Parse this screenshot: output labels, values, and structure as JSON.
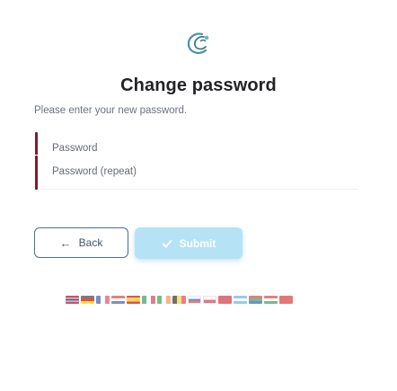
{
  "brand": {
    "logo_icon": "leaf-swirl-logo-icon",
    "accent": "#4a90a4"
  },
  "title": "Change password",
  "subtitle": "Please enter your new password.",
  "fields": {
    "password": {
      "placeholder": "Password",
      "value": ""
    },
    "password_repeat": {
      "placeholder": "Password (repeat)",
      "value": ""
    }
  },
  "buttons": {
    "back": {
      "label": "Back",
      "icon": "arrow-left-icon"
    },
    "submit": {
      "label": "Submit",
      "icon": "check-icon",
      "color": "#b6e2f5"
    }
  },
  "languages": [
    {
      "code": "gb",
      "icon": "flag-gb-icon"
    },
    {
      "code": "de",
      "icon": "flag-de-icon"
    },
    {
      "code": "fr",
      "icon": "flag-fr-icon"
    },
    {
      "code": "nl",
      "icon": "flag-nl-icon"
    },
    {
      "code": "es",
      "icon": "flag-es-icon"
    },
    {
      "code": "it",
      "icon": "flag-it-icon"
    },
    {
      "code": "ie",
      "icon": "flag-ie-icon"
    },
    {
      "code": "be",
      "icon": "flag-be-icon"
    },
    {
      "code": "ru",
      "icon": "flag-ru-icon"
    },
    {
      "code": "pl",
      "icon": "flag-pl-icon"
    },
    {
      "code": "tr",
      "icon": "flag-tr-icon"
    },
    {
      "code": "ar",
      "icon": "flag-ar-icon"
    },
    {
      "code": "za",
      "icon": "flag-za-icon"
    },
    {
      "code": "hu",
      "icon": "flag-hu-icon"
    },
    {
      "code": "cn",
      "icon": "flag-cn-icon"
    }
  ]
}
